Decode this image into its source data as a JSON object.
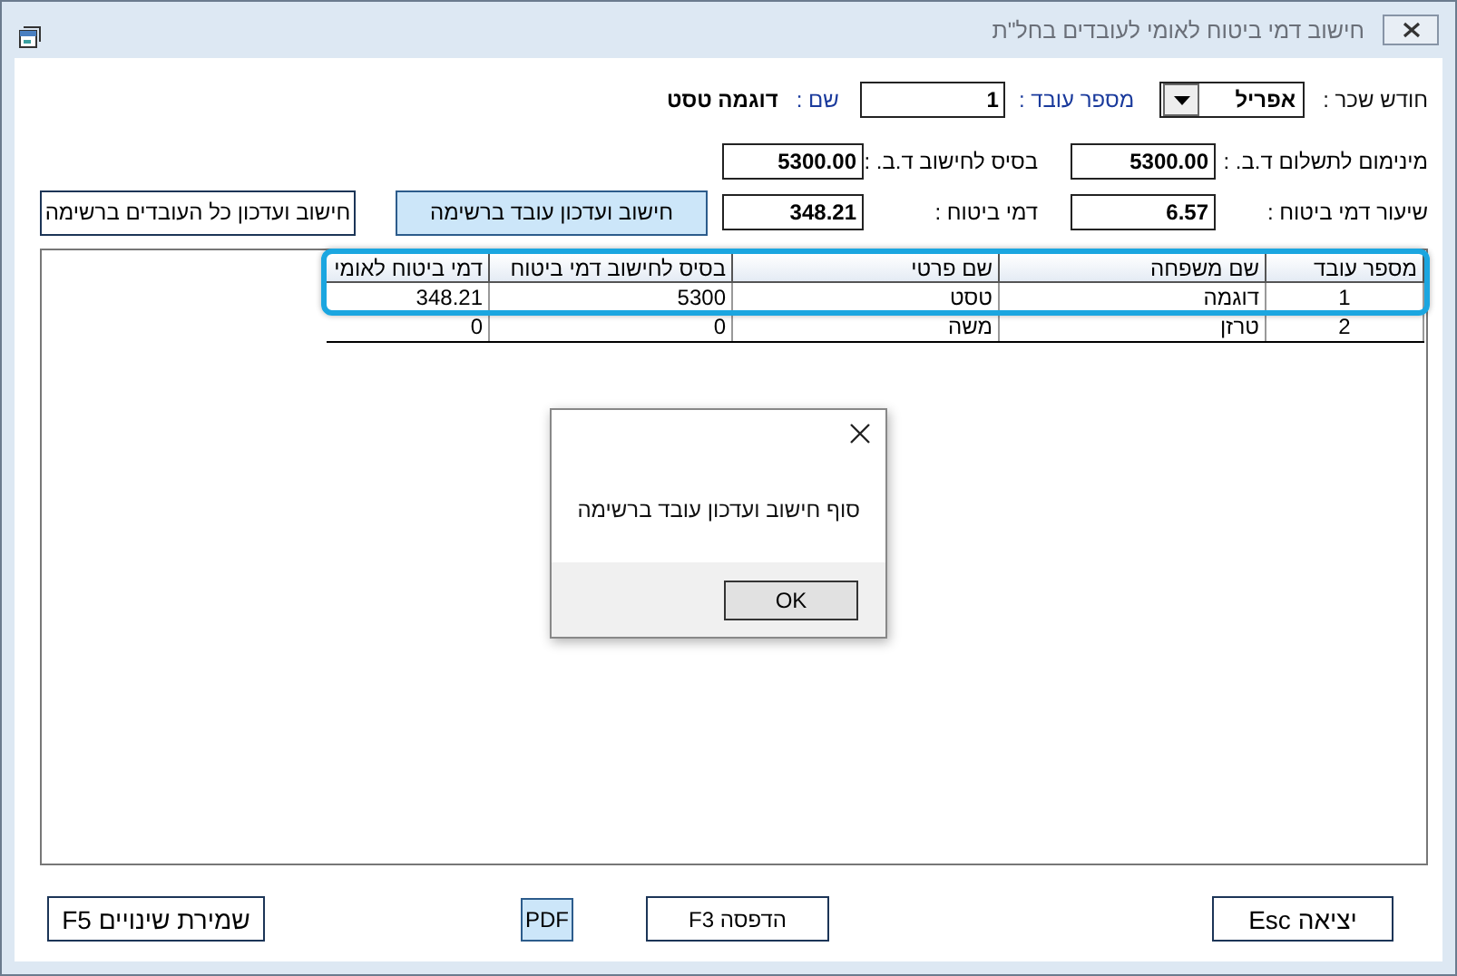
{
  "window": {
    "title": "חישוב דמי ביטוח לאומי לעובדים בחל\"ת"
  },
  "header_fields": [
    {
      "kind": "combo",
      "label": "חודש שכר :",
      "value": "אפריל"
    },
    {
      "kind": "input",
      "label": "מספר עובד :",
      "value": "1"
    },
    {
      "kind": "text",
      "label": "שם :",
      "value": "דוגמה טסט"
    }
  ],
  "calc_fields": [
    {
      "label": "מינימום לתשלום ד.ב. :",
      "value": "5300.00"
    },
    {
      "label": "בסיס לחישוב ד.ב. :",
      "value": "5300.00"
    },
    {
      "label": "שיעור דמי ביטוח :",
      "value": "6.57"
    },
    {
      "label": "דמי ביטוח :",
      "value": "348.21"
    }
  ],
  "action_buttons": [
    {
      "label": "חישוב ועדכון עובד ברשימה",
      "highlighted": true
    },
    {
      "label": "חישוב ועדכון כל העובדים ברשימה",
      "highlighted": false
    }
  ],
  "table": {
    "columns": [
      "מספר עובד",
      "שם משפחה",
      "שם פרטי",
      "בסיס לחישוב דמי ביטוח",
      "דמי ביטוח לאומי"
    ],
    "rows": [
      {
        "cells": [
          "1",
          "דוגמה",
          "טסט",
          "5300",
          "348.21"
        ],
        "selected": true
      },
      {
        "cells": [
          "2",
          "טרזן",
          "משה",
          "0",
          "0"
        ],
        "selected": false
      }
    ]
  },
  "dialog": {
    "message": "סוף חישוב ועדכון עובד ברשימה",
    "button": "OK"
  },
  "footer_buttons": [
    {
      "label": "יציאה Esc",
      "highlighted": false
    },
    {
      "label": "הדפסה F3",
      "highlighted": false
    },
    {
      "label": "PDF",
      "highlighted": true
    },
    {
      "label": "שמירת שינויים F5",
      "highlighted": false
    }
  ]
}
